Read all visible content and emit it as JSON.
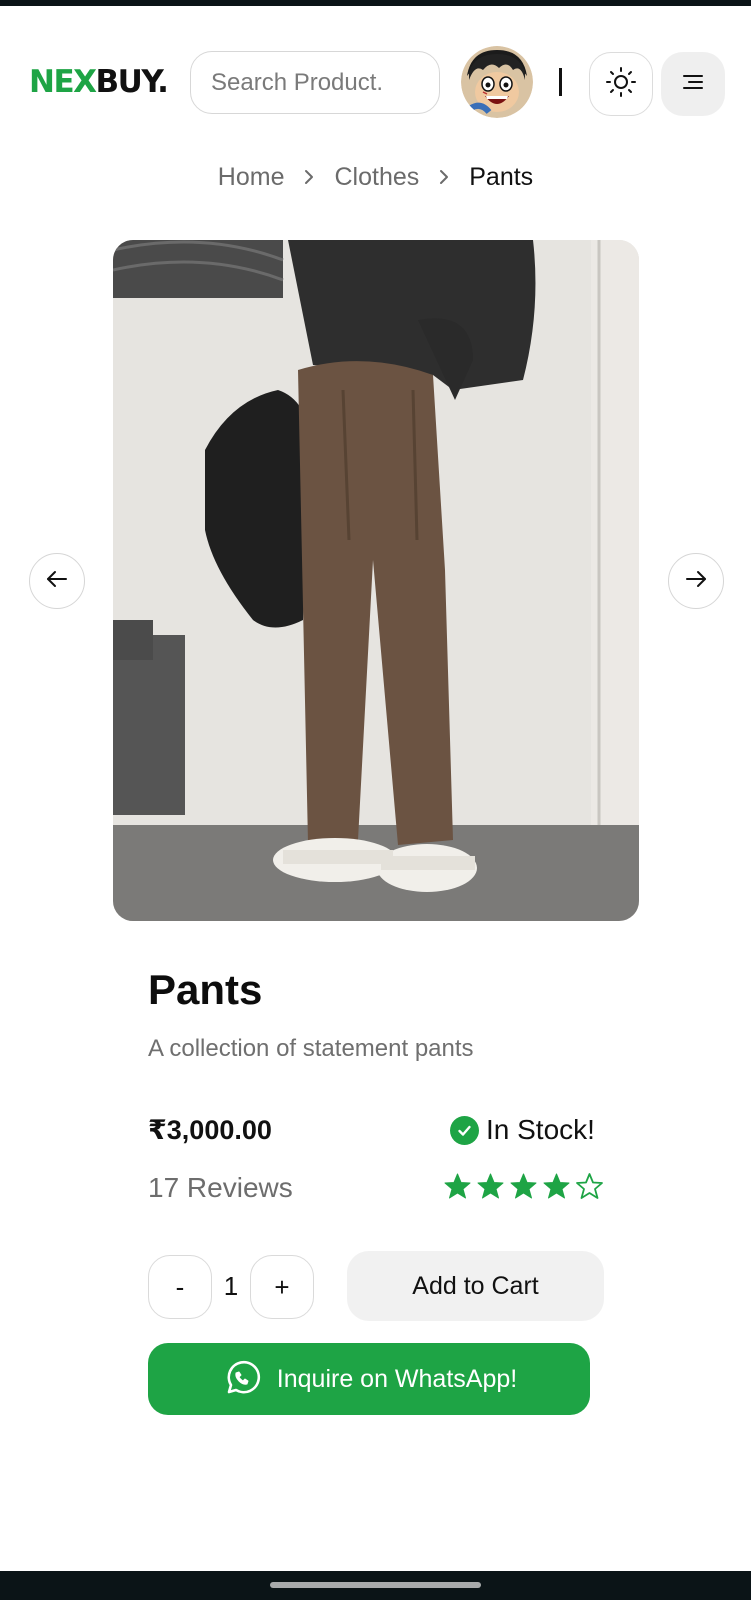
{
  "brand": {
    "part1": "NEX",
    "part2": "BUY.",
    "colors": {
      "accent": "#1ea445",
      "dark": "#111111"
    }
  },
  "header": {
    "search_placeholder": "Search Product.",
    "avatar_icon": "user-avatar-icon",
    "theme_icon": "sun-icon",
    "menu_icon": "menu-icon"
  },
  "breadcrumb": {
    "items": [
      "Home",
      "Clothes",
      "Pants"
    ],
    "separator_icon": "chevron-right-icon"
  },
  "gallery": {
    "image_alt": "Brown pleated pants",
    "prev_icon": "arrow-left-icon",
    "next_icon": "arrow-right-icon"
  },
  "product": {
    "title": "Pants",
    "description": "A collection of statement pants",
    "price": "₹3,000.00",
    "stock_status": "In Stock!",
    "reviews": "17 Reviews",
    "rating": 4,
    "rating_max": 5
  },
  "purchase": {
    "minus_label": "-",
    "quantity": "1",
    "plus_label": "+",
    "add_to_cart_label": "Add to Cart",
    "whatsapp_label": "Inquire on WhatsApp!"
  }
}
